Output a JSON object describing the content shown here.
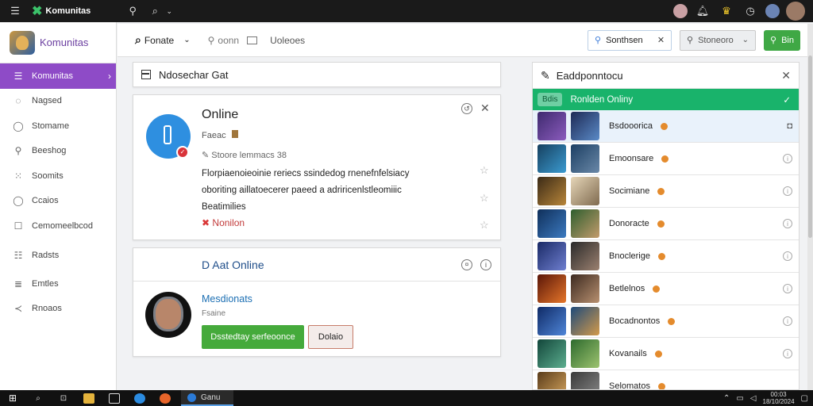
{
  "topbar": {
    "app_name": "Komunitas",
    "menu_icon": "hamburger-icon",
    "icons": [
      "location-icon",
      "search-icon",
      "chevron-down-icon"
    ],
    "right_icons": [
      "avatar",
      "bell-icon",
      "trophy-icon",
      "clock-icon",
      "avatar",
      "profile-avatar"
    ]
  },
  "sidebar": {
    "brand": "Komunitas",
    "items": [
      {
        "label": "Komunitas",
        "icon": "people-icon",
        "active": true
      },
      {
        "label": "Nagsed",
        "icon": "bookmark-icon",
        "active": false
      },
      {
        "label": "Stomame",
        "icon": "chat-icon",
        "active": false
      },
      {
        "label": "Beeshog",
        "icon": "pin-icon",
        "active": false
      },
      {
        "label": "Soomits",
        "icon": "grid-icon",
        "active": false
      },
      {
        "label": "Ccaios",
        "icon": "comment-icon",
        "active": false
      },
      {
        "label": "Cemomeelbcod",
        "icon": "square-icon",
        "active": false
      },
      {
        "label": "Radsts",
        "icon": "list-icon",
        "active": false
      },
      {
        "label": "Emtles",
        "icon": "lines-icon",
        "active": false
      },
      {
        "label": "Rnoaos",
        "icon": "share-icon",
        "active": false
      }
    ]
  },
  "header": {
    "primary_label": "Fonate",
    "search_label": "oonn",
    "tab_label": "Uoleoes",
    "search_pill": "Sonthsen",
    "dropdown": "Stoneoro",
    "button": "Bin"
  },
  "main": {
    "section_title": "Ndosechar Gat",
    "post": {
      "title": "Online",
      "meta": "Faeac",
      "sub_meta": "Stoore lemmacs 38",
      "body_line1": "Florpiaenoieoinie reriecs ssindedog rnenefnfelsiacy",
      "body_line2": "oboriting aillatoecerer paeed a adriricenlstleomiiic",
      "body_line3": "Beatimilies",
      "tag": "Nonilon"
    },
    "group": {
      "title": "D Aat Online",
      "member_name": "Mesdionats",
      "member_role": "Fsaine",
      "primary_button": "Dsstedtay serfeoonce",
      "secondary_button": "Dolaio"
    }
  },
  "right_panel": {
    "title": "Eaddponntocu",
    "banner_tag": "Bdis",
    "banner_text": "Ronlden Onliny",
    "rows": [
      {
        "name": "Bsdooorica"
      },
      {
        "name": "Emoonsare"
      },
      {
        "name": "Socimiane"
      },
      {
        "name": "Donoracte"
      },
      {
        "name": "Bnoclerige"
      },
      {
        "name": "Betlelnos"
      },
      {
        "name": "Bocadnontos"
      },
      {
        "name": "Kovanails"
      },
      {
        "name": "Selomatos"
      }
    ]
  },
  "taskbar": {
    "active_window": "Ganu",
    "time": "00:03",
    "date": "18/10/2024"
  }
}
